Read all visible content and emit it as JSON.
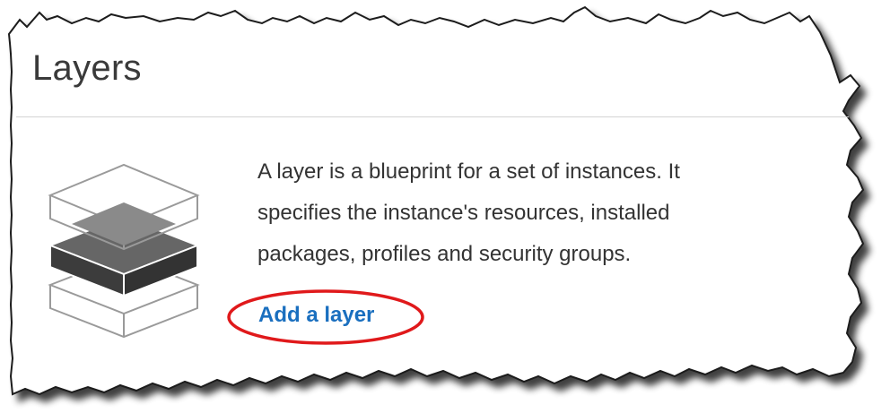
{
  "page": {
    "title": "Layers"
  },
  "description_lines": [
    "A layer is a blueprint for a set of instances. It",
    "specifies the instance's resources, installed",
    "packages, profiles and security groups."
  ],
  "actions": {
    "add_layer_label": "Add a layer"
  },
  "icons": {
    "layers": "layers-stack-icon"
  },
  "colors": {
    "link": "#1a6fbf",
    "highlight_ring": "#e0191b",
    "title_text": "#3a3a3a",
    "body_text": "#333333"
  }
}
